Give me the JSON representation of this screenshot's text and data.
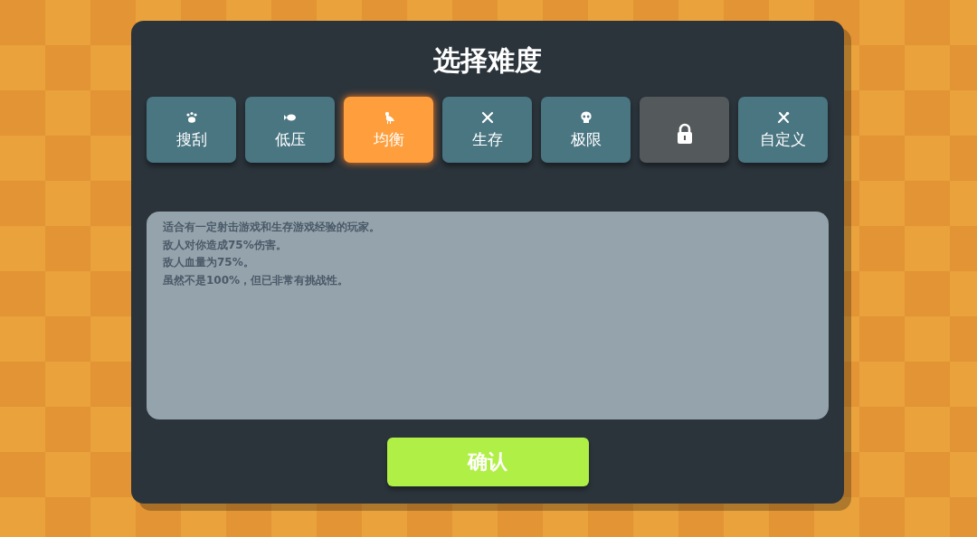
{
  "title": "选择难度",
  "tabs": [
    {
      "label": "搜刮",
      "selected": false,
      "locked": false
    },
    {
      "label": "低压",
      "selected": false,
      "locked": false
    },
    {
      "label": "均衡",
      "selected": true,
      "locked": false
    },
    {
      "label": "生存",
      "selected": false,
      "locked": false
    },
    {
      "label": "极限",
      "selected": false,
      "locked": false
    },
    {
      "selected": false,
      "locked": true
    },
    {
      "label": "自定义",
      "selected": false,
      "locked": false
    }
  ],
  "description": [
    "适合有一定射击游戏和生存游戏经验的玩家。",
    "敌人对你造成75%伤害。",
    "敌人血量为75%。",
    "虽然不是100%，但已非常有挑战性。"
  ],
  "confirm_button": "确认"
}
